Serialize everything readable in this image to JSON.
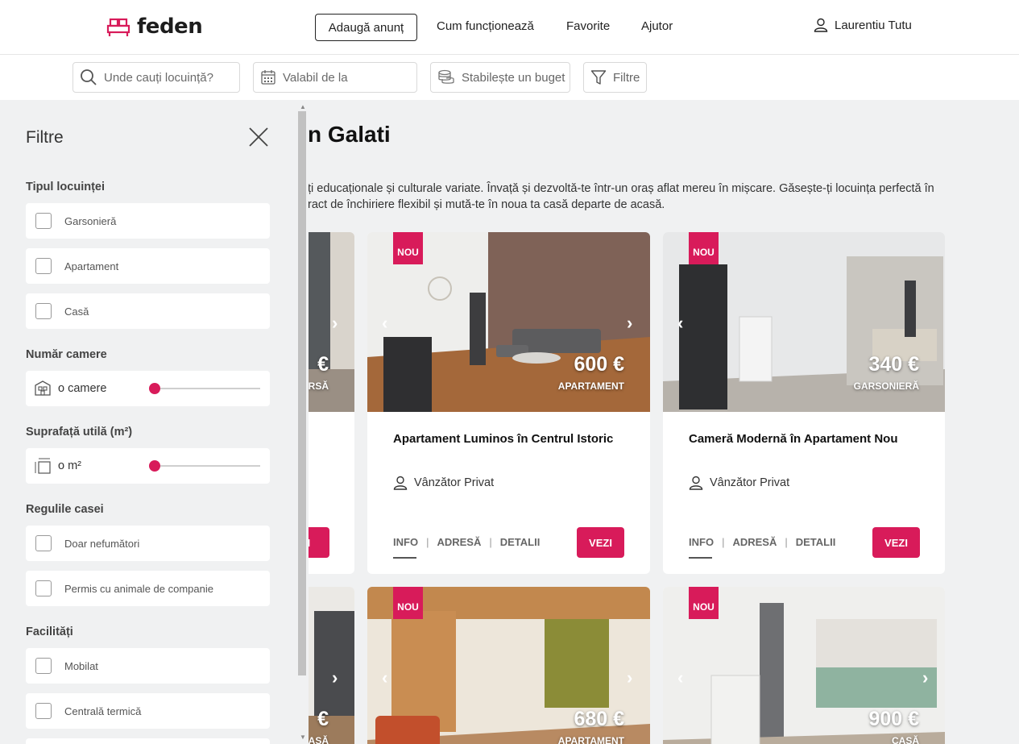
{
  "brand": {
    "name": "feden",
    "accent": "#d81b5a"
  },
  "nav": {
    "add_button": "Adaugă anunț",
    "links": [
      "Cum funcționează",
      "Favorite",
      "Ajutor"
    ],
    "user_name": "Laurentiu Tutu"
  },
  "search": {
    "location_placeholder": "Unde cauți locuință?",
    "date_placeholder": "Valabil de la",
    "budget_label": "Stabilește un buget",
    "filters_label": "Filtre"
  },
  "main": {
    "title": "n Galati",
    "description_line1": "ți educaționale și culturale variate. Învață și dezvoltă-te într-un oraș aflat mereu în mișcare. Găsește-ți locuința perfectă în",
    "description_line2": "ract de închiriere flexibil și mută-te în noua ta casă departe de acasă."
  },
  "cards": [
    {
      "badge": "",
      "price": "€",
      "type": "RSĂ",
      "title": "",
      "seller": "",
      "button": "ZI"
    },
    {
      "badge": "NOU",
      "price": "600 €",
      "type": "APARTAMENT",
      "title": "Apartament Luminos în Centrul Istoric",
      "seller": "Vânzător Privat",
      "tabs": [
        "INFO",
        "ADRESĂ",
        "DETALII"
      ],
      "button": "VEZI"
    },
    {
      "badge": "NOU",
      "price": "340 €",
      "type": "GARSONIERĂ",
      "title": "Cameră Modernă în Apartament Nou",
      "seller": "Vânzător Privat",
      "tabs": [
        "INFO",
        "ADRESĂ",
        "DETALII"
      ],
      "button": "VEZI"
    },
    {
      "badge": "",
      "price": "€",
      "type": "ASĂ"
    },
    {
      "badge": "NOU",
      "price": "680 €",
      "type": "APARTAMENT"
    },
    {
      "badge": "NOU",
      "price": "900 €",
      "type": "CASĂ"
    }
  ],
  "filters": {
    "title": "Filtre",
    "housing_type": {
      "label": "Tipul locuinței",
      "options": [
        "Garsonieră",
        "Apartament",
        "Casă"
      ]
    },
    "rooms": {
      "label": "Număr camere",
      "value_text": "o camere",
      "value": 0
    },
    "area": {
      "label": "Suprafață utilă (m²)",
      "value_text": "o m²",
      "value": 0
    },
    "rules": {
      "label": "Regulile casei",
      "options": [
        "Doar nefumători",
        "Permis cu animale de companie"
      ]
    },
    "facilities": {
      "label": "Facilități",
      "options": [
        "Mobilat",
        "Centrală termică"
      ]
    }
  }
}
